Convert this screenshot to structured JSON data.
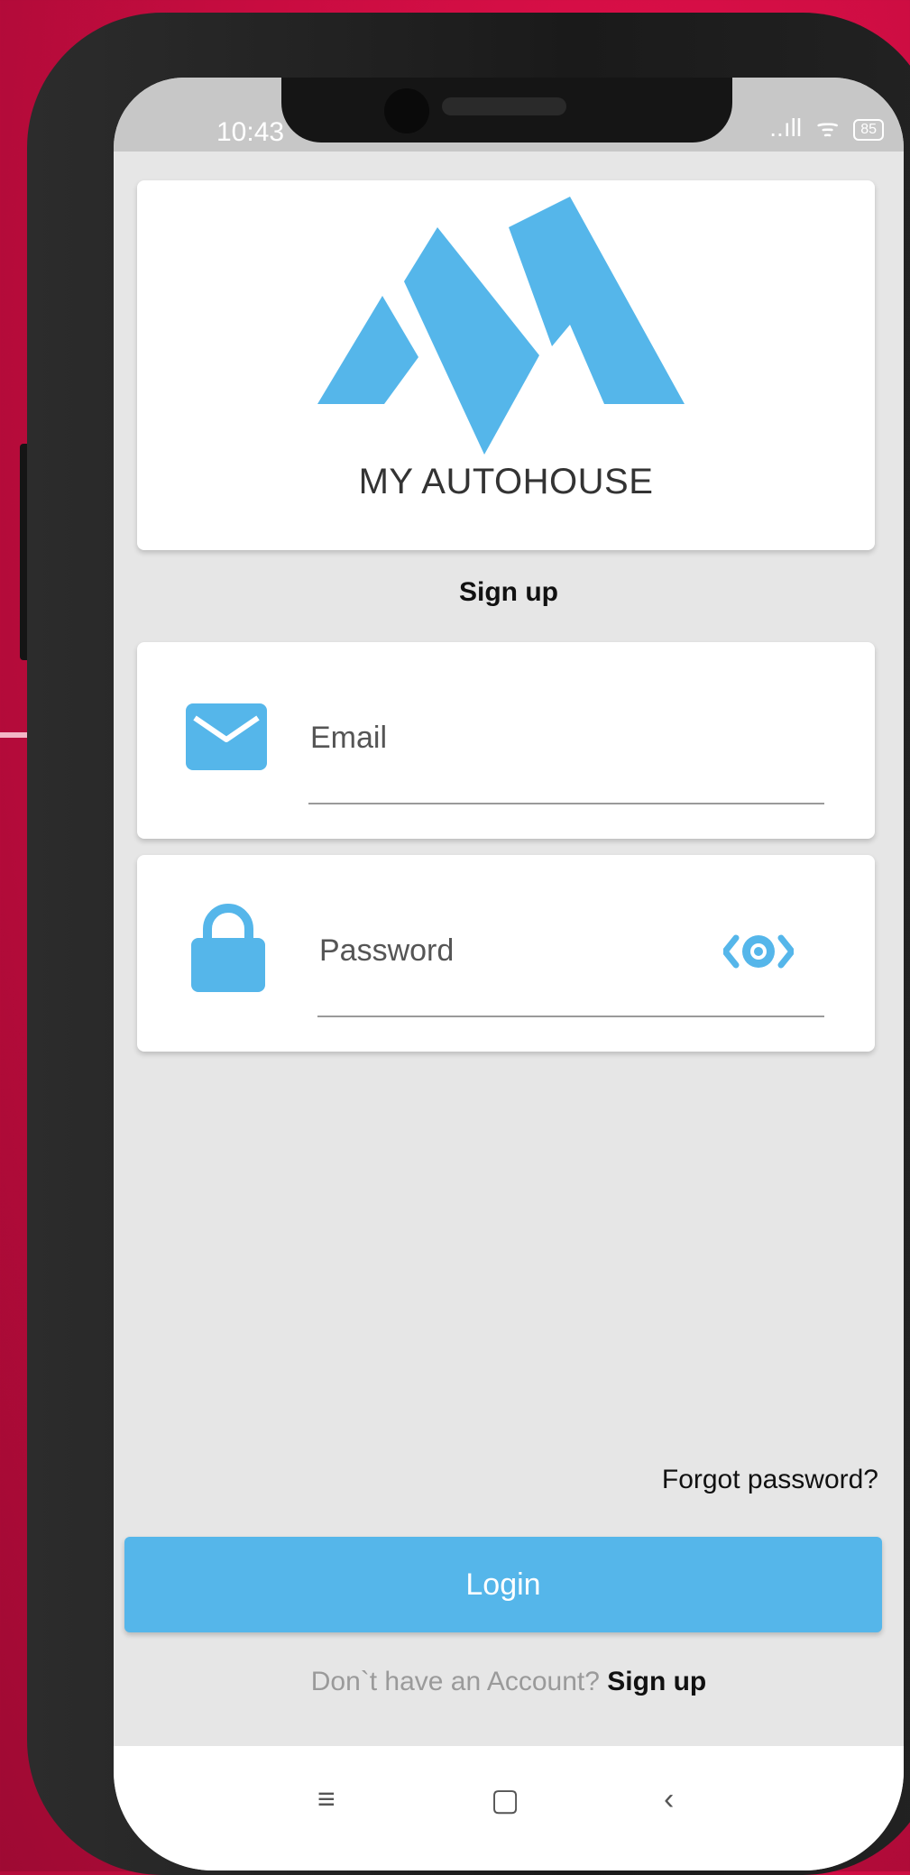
{
  "status_bar": {
    "time": "10:43",
    "signal": "..ıll",
    "wifi": "ᯤ",
    "battery": "85"
  },
  "brand": {
    "name": "MY AUTOHOUSE",
    "logo_color": "#55b6ea"
  },
  "page": {
    "title": "Sign up"
  },
  "form": {
    "email_placeholder": "Email",
    "password_placeholder": "Password",
    "icon_color": "#55b6ea"
  },
  "actions": {
    "forgot_password": "Forgot password?",
    "login_label": "Login",
    "no_account_prompt": "Don`t have an Account?",
    "signup_link": "Sign up"
  },
  "nav": {
    "menu_icon": "≡",
    "home_icon": "▢",
    "back_icon": "‹"
  }
}
